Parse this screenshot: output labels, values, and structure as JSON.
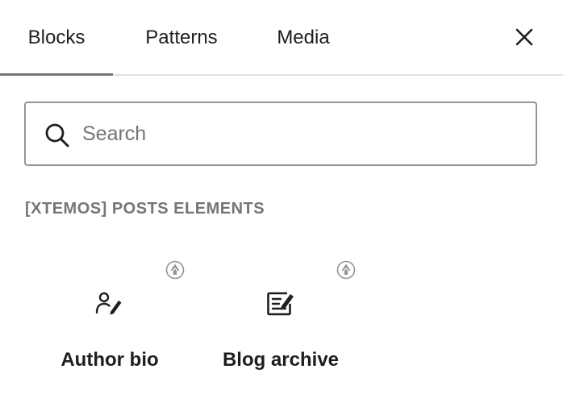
{
  "tabs": [
    {
      "label": "Blocks",
      "active": true
    },
    {
      "label": "Patterns",
      "active": false
    },
    {
      "label": "Media",
      "active": false
    }
  ],
  "close": {
    "icon": "close-icon"
  },
  "search": {
    "placeholder": "Search",
    "value": "",
    "icon": "search-icon"
  },
  "category": {
    "title": "[XTEMOS] POSTS ELEMENTS"
  },
  "blocks": [
    {
      "label": "Author bio",
      "icon": "author-bio-icon",
      "badge": "xtemos-badge-icon"
    },
    {
      "label": "Blog archive",
      "icon": "blog-archive-icon",
      "badge": "xtemos-badge-icon"
    }
  ],
  "colors": {
    "text": "#1e1e1e",
    "muted": "#757575",
    "border": "#949494",
    "divider": "#e0e0e0"
  }
}
